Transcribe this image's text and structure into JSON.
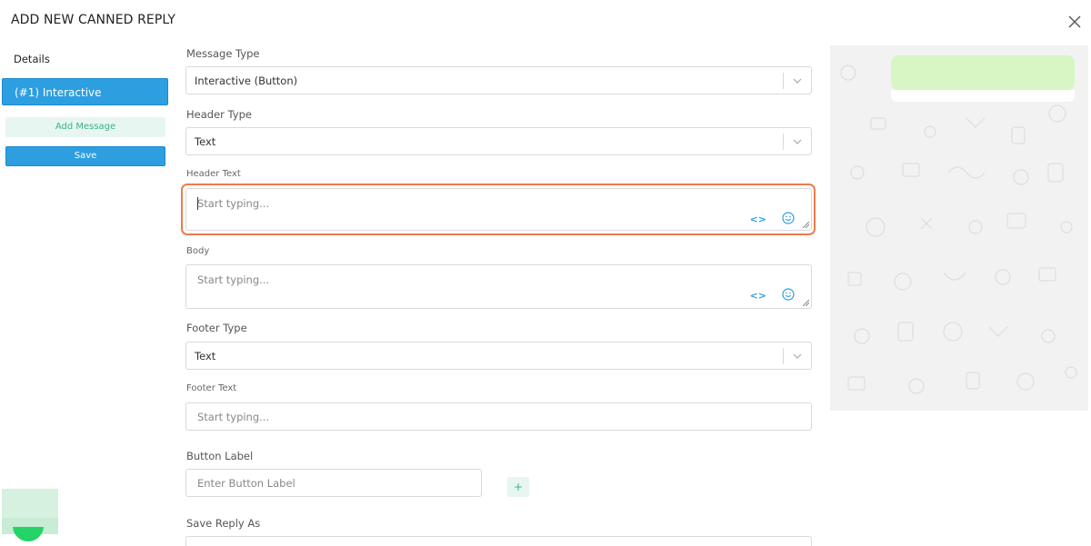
{
  "title": "ADD NEW CANNED REPLY",
  "sidebar": {
    "details_label": "Details",
    "message_item": "(#1) Interactive",
    "add_message": "Add Message",
    "save": "Save"
  },
  "form": {
    "message_type": {
      "label": "Message Type",
      "value": "Interactive (Button)"
    },
    "header_type": {
      "label": "Header Type",
      "value": "Text"
    },
    "header_text": {
      "label": "Header Text",
      "placeholder": "Start typing..."
    },
    "body": {
      "label": "Body",
      "placeholder": "Start typing..."
    },
    "footer_type": {
      "label": "Footer Type",
      "value": "Text"
    },
    "footer_text": {
      "label": "Footer Text",
      "placeholder": "Start typing..."
    },
    "button_label": {
      "label": "Button Label",
      "placeholder": "Enter Button Label"
    },
    "add_button": "+",
    "save_reply_as": {
      "label": "Save Reply As"
    }
  },
  "icons": {
    "code": "<>",
    "emoji": "smiley-icon",
    "close": "close-icon",
    "chevron": "chevron-down-icon"
  },
  "colors": {
    "accent": "#2d9ee0",
    "focus": "#ee7b4a",
    "success": "#3bb18a",
    "bubble": "#d8f6c4"
  }
}
